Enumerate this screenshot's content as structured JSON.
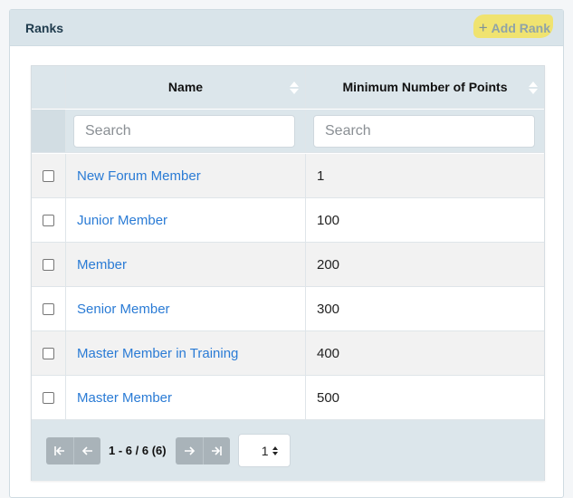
{
  "header": {
    "title": "Ranks",
    "add_label": "Add Rank",
    "add_icon": "+"
  },
  "table": {
    "columns": [
      "Name",
      "Minimum Number of Points"
    ],
    "search_placeholders": [
      "Search",
      "Search"
    ],
    "rows": [
      {
        "name": "New Forum Member",
        "points": "1"
      },
      {
        "name": "Junior Member",
        "points": "100"
      },
      {
        "name": "Member",
        "points": "200"
      },
      {
        "name": "Senior Member",
        "points": "300"
      },
      {
        "name": "Master Member in Training",
        "points": "400"
      },
      {
        "name": "Master Member",
        "points": "500"
      }
    ]
  },
  "pagination": {
    "info": "1 - 6 / 6 (6)",
    "page": "1"
  },
  "colors": {
    "accent": "#2a7bd5",
    "header_bg": "#d9e4ea",
    "highlight": "#f3e35a"
  }
}
